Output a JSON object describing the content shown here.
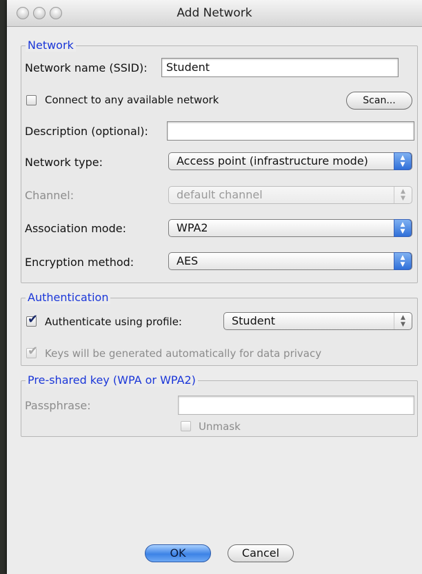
{
  "window": {
    "title": "Add Network"
  },
  "network": {
    "legend": "Network",
    "ssid_label": "Network name (SSID):",
    "ssid_value": "Student",
    "connect_any_label": "Connect to any available network",
    "connect_any_checked": false,
    "scan_button": "Scan...",
    "description_label": "Description (optional):",
    "description_value": "",
    "network_type_label": "Network type:",
    "network_type_value": "Access point (infrastructure mode)",
    "channel_label": "Channel:",
    "channel_value": "default channel",
    "association_label": "Association mode:",
    "association_value": "WPA2",
    "encryption_label": "Encryption method:",
    "encryption_value": "AES"
  },
  "authentication": {
    "legend": "Authentication",
    "profile_label": "Authenticate using profile:",
    "profile_checked": true,
    "profile_value": "Student",
    "keys_label": "Keys will be generated automatically for data privacy",
    "keys_checked": true
  },
  "psk": {
    "legend": "Pre-shared key (WPA or WPA2)",
    "passphrase_label": "Passphrase:",
    "passphrase_value": "",
    "unmask_label": "Unmask",
    "unmask_checked": false
  },
  "buttons": {
    "ok": "OK",
    "cancel": "Cancel"
  },
  "icons": {
    "close": "close-icon",
    "minimize": "minimize-icon",
    "zoom": "zoom-icon",
    "popup_arrows": "up-down-arrows-icon",
    "check": "checkmark-icon"
  },
  "colors": {
    "legend": "#1a36d8",
    "default_button": "#3d83e6",
    "window_bg": "#ececec"
  }
}
